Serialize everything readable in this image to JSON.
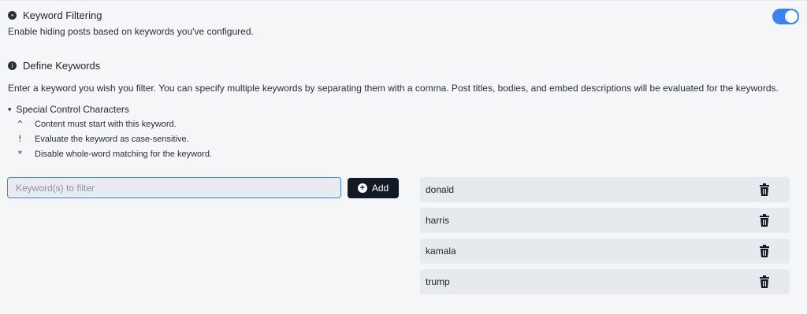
{
  "filtering": {
    "title": "Keyword Filtering",
    "description": "Enable hiding posts based on keywords you've configured.",
    "enabled": true,
    "icon": "info-icon"
  },
  "define": {
    "title": "Define Keywords",
    "description": "Enter a keyword you wish you filter. You can specify multiple keywords by separating them with a comma. Post titles, bodies, and embed descriptions will be evaluated for the keywords.",
    "icon": "info-icon"
  },
  "special": {
    "label": "Special Control Characters",
    "caret": "▾",
    "rows": [
      {
        "symbol": "^",
        "text": "Content must start with this keyword."
      },
      {
        "symbol": "!",
        "text": "Evaluate the keyword as case-sensitive."
      },
      {
        "symbol": "*",
        "text": "Disable whole-word matching for the keyword."
      }
    ]
  },
  "input": {
    "placeholder": "Keyword(s) to filter",
    "value": ""
  },
  "add_button": {
    "label": "Add",
    "icon": "plus-circle-icon"
  },
  "keywords": [
    {
      "text": "donald"
    },
    {
      "text": "harris"
    },
    {
      "text": "kamala"
    },
    {
      "text": "trump"
    }
  ],
  "colors": {
    "accent": "#3b82f6",
    "button_dark": "#141a25"
  }
}
